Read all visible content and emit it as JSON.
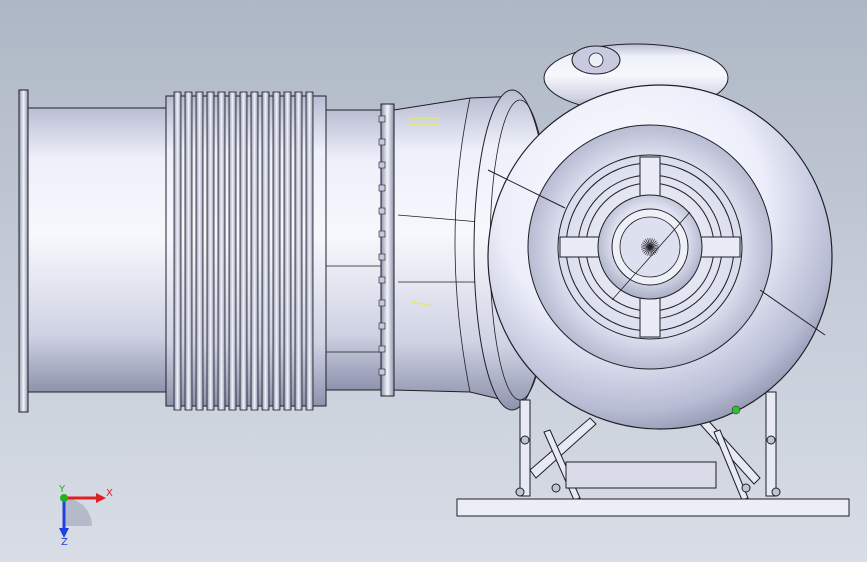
{
  "viewport": {
    "background_top": "#aeb7c5",
    "background_bottom": "#d8dde6",
    "model_fill": "#e6e8f4",
    "model_shade": "#9a9fb8",
    "edge_color": "#1f1f26",
    "accent_green": "#2fbf2f"
  },
  "triad": {
    "x_label": "X",
    "y_label": "Y",
    "z_label": "Z",
    "x_color": "#e02020",
    "y_color": "#20b020",
    "z_color": "#2040e0"
  }
}
